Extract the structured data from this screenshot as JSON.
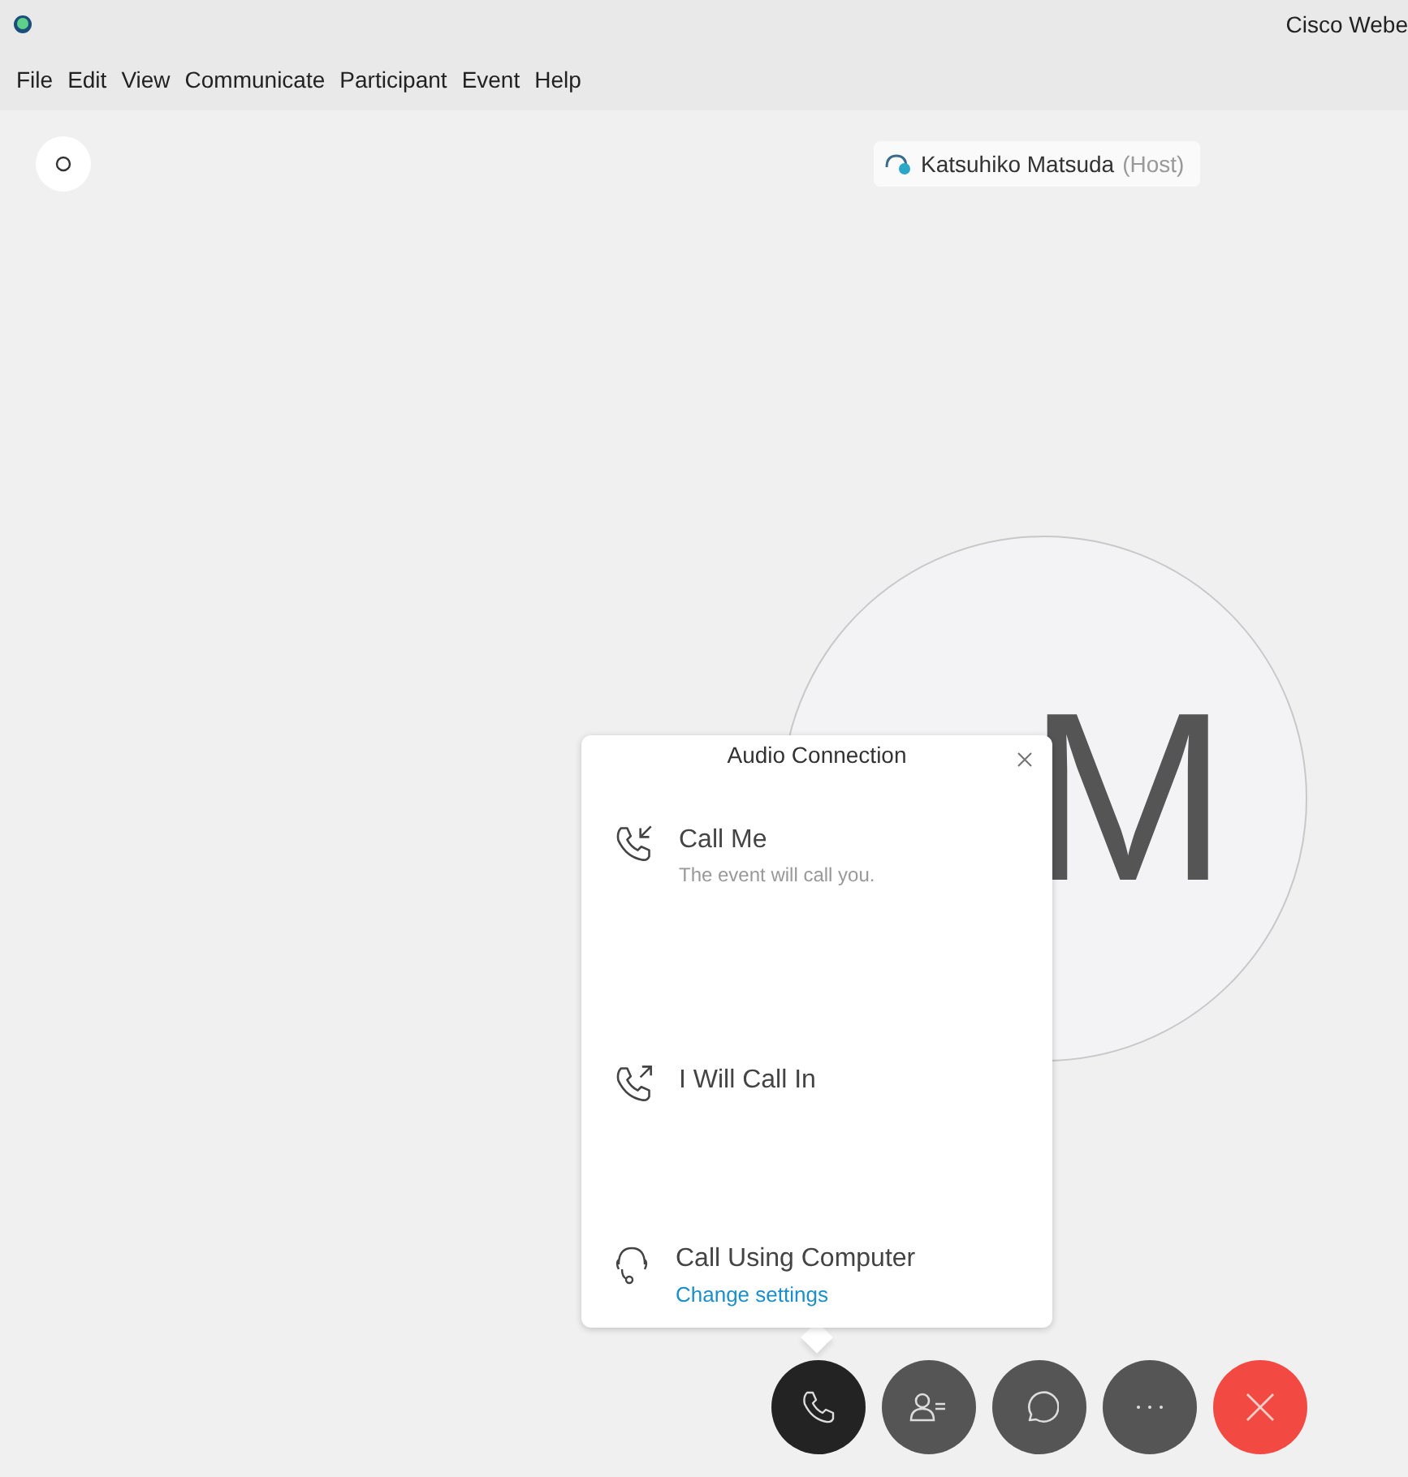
{
  "window": {
    "title": "Cisco Webe"
  },
  "menu": [
    "File",
    "Edit",
    "View",
    "Communicate",
    "Participant",
    "Event",
    "Help"
  ],
  "stage": {
    "host": {
      "name": "Katsuhiko Matsuda",
      "role": "(Host)"
    },
    "avatar_initials": "M"
  },
  "audio_popup": {
    "title": "Audio Connection",
    "options": [
      {
        "kind": "call-me",
        "label": "Call Me",
        "description": "The event will call you."
      },
      {
        "kind": "call-in",
        "label": "I Will Call In"
      },
      {
        "kind": "computer",
        "label": "Call Using Computer",
        "link": "Change settings"
      }
    ]
  },
  "controls": [
    {
      "kind": "audio",
      "selected": true
    },
    {
      "kind": "participants",
      "selected": false
    },
    {
      "kind": "chat",
      "selected": false
    },
    {
      "kind": "more",
      "selected": false
    },
    {
      "kind": "leave",
      "selected": false
    }
  ]
}
